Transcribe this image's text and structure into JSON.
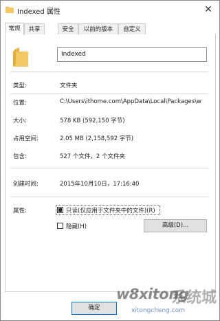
{
  "window": {
    "title": "Indexed 属性",
    "close_glyph": "✕"
  },
  "tabs": [
    {
      "label": "常规",
      "active": true
    },
    {
      "label": "共享",
      "active": false
    },
    {
      "label": "安全",
      "active": false
    },
    {
      "label": "以前的版本",
      "active": false
    },
    {
      "label": "自定义",
      "active": false
    }
  ],
  "name_field": {
    "value": "Indexed"
  },
  "properties": {
    "type": {
      "label": "类型:",
      "value": "文件夹"
    },
    "location": {
      "label": "位置:",
      "value": "C:\\Users\\ithome.com\\AppData\\Local\\Packages\\w"
    },
    "size": {
      "label": "大小:",
      "value": "578 KB (592,150 字节)"
    },
    "size_on_disk": {
      "label": "占用空间:",
      "value": "2.05 MB (2,158,592 字节)"
    },
    "contains": {
      "label": "包含:",
      "value": "527 个文件，2 个文件夹"
    },
    "created": {
      "label": "创建时间:",
      "value": "2015年10月10日，17:16:40"
    },
    "attributes": {
      "label": "属性:"
    }
  },
  "attributes": {
    "readonly": {
      "label": "只读(仅应用于文件夹中的文件)(R)",
      "checked": true
    },
    "hidden": {
      "label": "隐藏(H)",
      "checked": false
    },
    "advanced_button": "高级(D)..."
  },
  "footer": {
    "ok_button": "确定"
  },
  "watermark": {
    "brand": "w8xitong",
    "cn": "系统城",
    "url": "xitongcheng.com"
  },
  "icons": {
    "folder": "folder-icon",
    "title": "folder-small-icon",
    "close": "close-icon"
  },
  "colors": {
    "folder_fill": "#f3c863",
    "folder_tab": "#e9b646",
    "accent": "#0078d7"
  }
}
